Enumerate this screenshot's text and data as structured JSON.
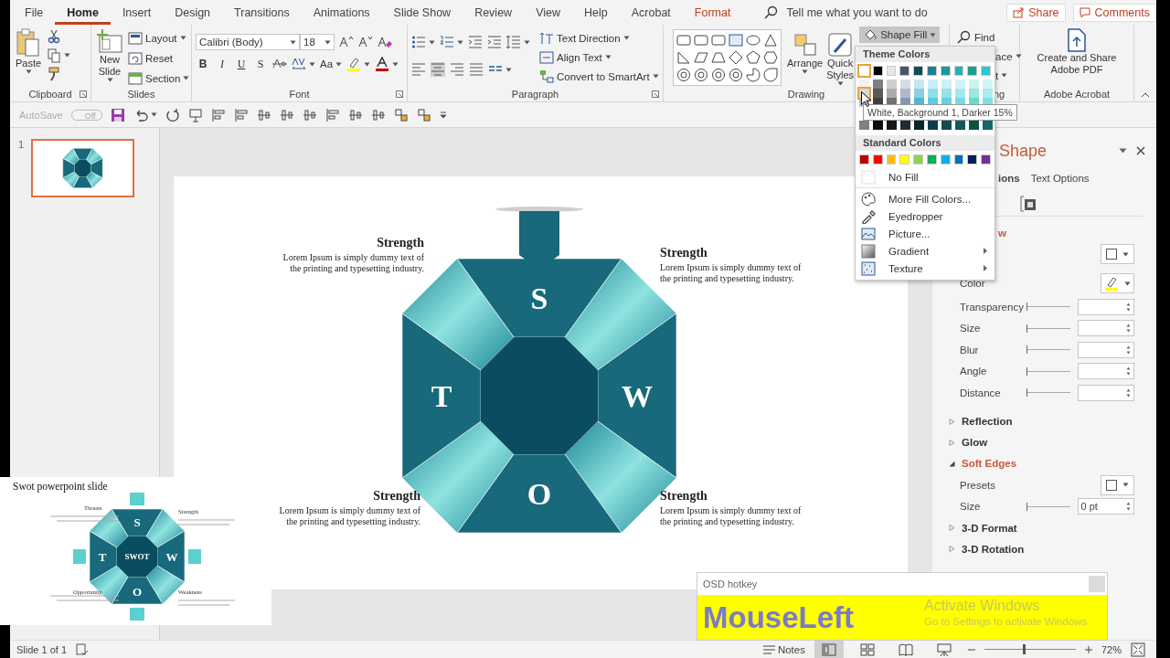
{
  "tabs": [
    {
      "label": "File",
      "selected": false,
      "kind": "plain"
    },
    {
      "label": "Home",
      "selected": true,
      "kind": "plain"
    },
    {
      "label": "Insert",
      "selected": false,
      "kind": "plain"
    },
    {
      "label": "Design",
      "selected": false,
      "kind": "plain"
    },
    {
      "label": "Transitions",
      "selected": false,
      "kind": "plain"
    },
    {
      "label": "Animations",
      "selected": false,
      "kind": "plain"
    },
    {
      "label": "Slide Show",
      "selected": false,
      "kind": "plain"
    },
    {
      "label": "Review",
      "selected": false,
      "kind": "plain"
    },
    {
      "label": "View",
      "selected": false,
      "kind": "plain"
    },
    {
      "label": "Help",
      "selected": false,
      "kind": "plain"
    },
    {
      "label": "Acrobat",
      "selected": false,
      "kind": "plain"
    },
    {
      "label": "Format",
      "selected": false,
      "kind": "contextual"
    }
  ],
  "tell_me": {
    "placeholder": "Tell me what you want to do"
  },
  "share": "Share",
  "comments": "Comments",
  "ribbon": {
    "clipboard": {
      "label": "Clipboard",
      "paste": "Paste"
    },
    "slides": {
      "label": "Slides",
      "new_slide": "New Slide",
      "layout": "Layout",
      "reset": "Reset",
      "section": "Section"
    },
    "font": {
      "label": "Font",
      "font_name": "Calibri (Body)",
      "font_size": "18",
      "styles": [
        "B",
        "I",
        "U",
        "S"
      ],
      "change_case": "Aa"
    },
    "paragraph": {
      "label": "Paragraph",
      "text_direction": "Text Direction",
      "align_text": "Align Text",
      "smartart": "Convert to SmartArt"
    },
    "drawing": {
      "label": "Drawing",
      "arrange": "Arrange",
      "quick_styles": "Quick Styles",
      "shape_fill": "Shape Fill",
      "shape_fill_open": true
    },
    "editing": {
      "find": "Find",
      "replace": "ace",
      "select": "t",
      "label": "ng"
    },
    "acrobat": {
      "label": "Adobe Acrobat",
      "create": "Create and Share Adobe PDF"
    }
  },
  "quick_access": {
    "autosave": "AutoSave",
    "toggle": "Off",
    "on": false
  },
  "thumbnails": [
    {
      "number": "1",
      "selected": true
    }
  ],
  "slide": {
    "letters": [
      "S",
      "W",
      "O",
      "T"
    ],
    "blocks": [
      {
        "title": "Strength",
        "body": "Lorem Ipsum is simply dummy text of the printing and typesetting industry."
      },
      {
        "title": "Strength",
        "body": "Lorem Ipsum is simply dummy text of the printing and typesetting industry."
      },
      {
        "title": "Strength",
        "body": "Lorem Ipsum is simply dummy text of the printing and typesetting industry."
      },
      {
        "title": "Strength",
        "body": "Lorem Ipsum is simply dummy text of the printing and typesetting industry."
      }
    ]
  },
  "shape_fill_menu": {
    "theme_title": "Theme Colors",
    "theme": [
      {
        "color": "#ffffff",
        "selected": true
      },
      {
        "color": "#000000",
        "selected": false
      },
      {
        "color": "#e7e6e6",
        "selected": false
      },
      {
        "color": "#44546a",
        "selected": false
      },
      {
        "color": "#0f4c5c",
        "selected": false
      },
      {
        "color": "#1a7f93",
        "selected": false
      },
      {
        "color": "#1e96a0",
        "selected": false
      },
      {
        "color": "#26b0b8",
        "selected": false
      },
      {
        "color": "#1f9e8a",
        "selected": false
      },
      {
        "color": "#2cc9ce",
        "selected": false
      }
    ],
    "shades": [
      [
        {
          "color": "#f2f2f2",
          "selected": false
        },
        {
          "color": "#7f7f7f",
          "selected": false
        },
        {
          "color": "#d0cece",
          "selected": false
        },
        {
          "color": "#d6dce5",
          "selected": false
        },
        {
          "color": "#c5e7f0",
          "selected": false
        },
        {
          "color": "#c9eef6",
          "selected": false
        },
        {
          "color": "#ccf0f3",
          "selected": false
        },
        {
          "color": "#d2f3f5",
          "selected": false
        },
        {
          "color": "#cdf3ed",
          "selected": false
        },
        {
          "color": "#d4f5f6",
          "selected": false
        }
      ],
      [
        {
          "color": "#d9d9d9",
          "selected": true
        },
        {
          "color": "#595959",
          "selected": false
        },
        {
          "color": "#aeabab",
          "selected": false
        },
        {
          "color": "#adb9ca",
          "selected": false
        },
        {
          "color": "#8bcfe1",
          "selected": false
        },
        {
          "color": "#93dded",
          "selected": false
        },
        {
          "color": "#99e1e7",
          "selected": false
        },
        {
          "color": "#a5e7eb",
          "selected": false
        },
        {
          "color": "#9be7db",
          "selected": false
        },
        {
          "color": "#aaebed",
          "selected": false
        }
      ],
      [
        {
          "color": "#bfbfbf",
          "selected": false
        },
        {
          "color": "#404040",
          "selected": false
        },
        {
          "color": "#757070",
          "selected": false
        },
        {
          "color": "#8497b0",
          "selected": false
        },
        {
          "color": "#52b7d2",
          "selected": false
        },
        {
          "color": "#5ccce4",
          "selected": false
        },
        {
          "color": "#66d2dc",
          "selected": false
        },
        {
          "color": "#78dbe1",
          "selected": false
        },
        {
          "color": "#69dbc9",
          "selected": false
        },
        {
          "color": "#80e1e3",
          "selected": false
        }
      ],
      [
        {
          "color": "#808080",
          "selected": false
        },
        {
          "color": "#0d0d0d",
          "selected": false
        },
        {
          "color": "#171616",
          "selected": false
        },
        {
          "color": "#222a35",
          "selected": false
        },
        {
          "color": "#07262e",
          "selected": false
        },
        {
          "color": "#0d3f49",
          "selected": false
        },
        {
          "color": "#0f4b50",
          "selected": false
        },
        {
          "color": "#13585c",
          "selected": false
        },
        {
          "color": "#104f45",
          "selected": false
        },
        {
          "color": "#166769",
          "selected": false
        }
      ]
    ],
    "standard_title": "Standard Colors",
    "standard": [
      {
        "color": "#c00000",
        "selected": false
      },
      {
        "color": "#ff0000",
        "selected": false
      },
      {
        "color": "#ffc000",
        "selected": false
      },
      {
        "color": "#ffff00",
        "selected": false
      },
      {
        "color": "#92d050",
        "selected": false
      },
      {
        "color": "#00b050",
        "selected": false
      },
      {
        "color": "#00b0f0",
        "selected": false
      },
      {
        "color": "#0070c0",
        "selected": false
      },
      {
        "color": "#002060",
        "selected": false
      },
      {
        "color": "#7030a0",
        "selected": false
      }
    ],
    "items": [
      {
        "label": "No Fill",
        "kind": "nofill",
        "submenu": false
      },
      {
        "label": "More Fill Colors...",
        "kind": "palette",
        "submenu": false
      },
      {
        "label": "Eyedropper",
        "kind": "eyedropper",
        "submenu": false
      },
      {
        "label": "Picture...",
        "kind": "picture",
        "submenu": false
      },
      {
        "label": "Gradient",
        "kind": "gradient",
        "submenu": true
      },
      {
        "label": "Texture",
        "kind": "texture",
        "submenu": true
      }
    ]
  },
  "tooltip": "White, Background 1, Darker 15%",
  "format_pane": {
    "title": "Shape",
    "tabs": [
      {
        "label": "ions",
        "selected": true
      },
      {
        "label": "Text Options",
        "selected": false
      }
    ],
    "sections": [
      {
        "title": "w",
        "expanded": true,
        "rows": [
          {
            "kind": "dropdown"
          },
          {
            "kind": "color",
            "label": "Color"
          },
          {
            "kind": "slider",
            "label": "Transparency",
            "level": 0
          },
          {
            "kind": "slider",
            "label": "Size",
            "level": 0
          },
          {
            "kind": "slider",
            "label": "Blur",
            "level": 0
          },
          {
            "kind": "slider",
            "label": "Angle",
            "level": 0
          },
          {
            "kind": "slider",
            "label": "Distance",
            "level": 0
          }
        ]
      },
      {
        "title": "Reflection",
        "expanded": false
      },
      {
        "title": "Glow",
        "expanded": false
      },
      {
        "title": "Soft Edges",
        "expanded": true,
        "rows": [
          {
            "kind": "dropdown",
            "label": "Presets"
          },
          {
            "kind": "slider",
            "label": "Size",
            "level": 0,
            "value": "0 pt"
          }
        ]
      },
      {
        "title": "3-D Format",
        "expanded": false
      },
      {
        "title": "3-D Rotation",
        "expanded": false
      }
    ]
  },
  "inset": {
    "title": "Swot powerpoint slide",
    "center": "SWOT",
    "letters": [
      "S",
      "W",
      "O",
      "T"
    ],
    "labels": [
      "Threats",
      "Strength",
      "Opportunity",
      "Weakness"
    ]
  },
  "osd": {
    "title": "OSD hotkey",
    "key": "MouseLeft"
  },
  "activation": {
    "title": "Activate Windows",
    "body": "Go to Settings to activate Windows"
  },
  "status_bar": {
    "slide": "Slide 1 of 1",
    "notes": "Notes",
    "views": [
      {
        "kind": "normal",
        "selected": true
      },
      {
        "kind": "sorter",
        "selected": false
      },
      {
        "kind": "reading",
        "selected": false
      },
      {
        "kind": "show",
        "selected": false
      }
    ],
    "zoom": {
      "level": 0.42,
      "label": "72%"
    }
  }
}
